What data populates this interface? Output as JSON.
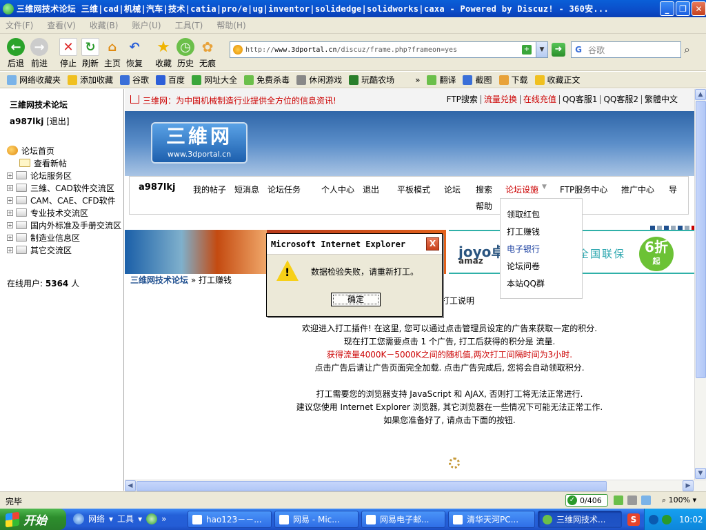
{
  "window": {
    "title": "三维网技术论坛 三维|cad|机械|汽车|技术|catia|pro/e|ug|inventor|solidedge|solidworks|caxa - Powered by Discuz! - 360安..."
  },
  "menubar": [
    "文件(F)",
    "查看(V)",
    "收藏(B)",
    "账户(U)",
    "工具(T)",
    "帮助(H)"
  ],
  "toolbar": {
    "back": "后退",
    "forward": "前进",
    "stop": "停止",
    "refresh": "刷新",
    "home": "主页",
    "restore": "恢复",
    "favorites": "收藏",
    "history": "历史",
    "incognito": "无痕",
    "url_prefix": "http://",
    "url_host": "www.3dportal.cn",
    "url_path": "/discuz/frame.php?frameon=yes",
    "search_placeholder": "谷歌"
  },
  "favbar": {
    "items": [
      "网络收藏夹",
      "添加收藏",
      "谷歌",
      "百度",
      "网址大全",
      "免费杀毒",
      "休闲游戏",
      "玩酷农场"
    ],
    "right": [
      "翻译",
      "截图",
      "下载",
      "收藏正文"
    ]
  },
  "left": {
    "title": "三維网技术论坛",
    "username": "a987lkj",
    "logout": "[退出]",
    "tree": [
      "论坛首页",
      "查看新帖",
      "论坛服务区",
      "三維、CAD软件交流区",
      "CAM、CAE、CFD软件",
      "专业技术交流区",
      "国内外标准及手册交流区",
      "制造业信息区",
      "其它交流区"
    ],
    "online_label": "在线用户:",
    "online_count": "5364",
    "online_unit": "人"
  },
  "main": {
    "notice": "三维网：为中国机械制造行业提供全方位的信息资讯!",
    "toplinks": [
      "FTP搜索",
      "流量兑换",
      "在线充值",
      "QQ客服1",
      "QQ客服2",
      "繁體中文"
    ],
    "logo_cn": "三維网",
    "logo_en": "www.3dportal.cn",
    "nav": {
      "user": "a987lkj",
      "items": [
        "我的帖子",
        "短消息",
        "论坛任务",
        "个人中心",
        "退出",
        "平板模式",
        "论坛",
        "搜索",
        "论坛设施",
        "FTP服务中心",
        "推广中心",
        "导"
      ],
      "help": "帮助"
    },
    "dropdown": [
      "领取红包",
      "打工赚钱",
      "电子银行",
      "论坛问卷",
      "本站QQ群"
    ],
    "ad": {
      "joyo": "joyo卓",
      "amazon": "amaz",
      "lianbao": "全国联保",
      "discount": "6折",
      "discount_suffix": "起"
    },
    "breadcrumb_home": "三维网技术论坛",
    "breadcrumb_sep": "»",
    "breadcrumb_current": "打工赚钱",
    "explain_title": "打工说明",
    "lines": [
      "欢迎进入打工插件! 在这里, 您可以通过点击管理员设定的广告来获取一定的积分.",
      "现在打工您需要点击 1 个广告, 打工后获得的积分是 流量.",
      "获得流量4000K－5000K之间的随机值,两次打工间隔时间为3小时.",
      "点击广告后请让广告页面完全加载. 点击广告完成后, 您将会自动领取积分.",
      "打工需要您的浏览器支持 JavaScript 和 AJAX, 否则打工将无法正常进行.",
      "建议您使用 Internet Explorer 浏览器, 其它浏览器在一些情况下可能无法正常工作.",
      "如果您准备好了, 请点击下面的按钮."
    ]
  },
  "dialog": {
    "title": "Microsoft Internet Explorer",
    "message": "数据检验失败，请重新打工。",
    "ok": "确定",
    "close": "X"
  },
  "status": {
    "text": "完毕",
    "counter": "0/406",
    "zoom": "100%"
  },
  "taskbar": {
    "start": "开始",
    "quick": [
      "网络",
      "工具"
    ],
    "tasks": [
      "hao123－－...",
      "网易 - Mic...",
      "网易电子邮...",
      "清华天河PC...",
      "三维网技术..."
    ],
    "clock": "10:02"
  },
  "colors": {
    "title_bar": "#0b4dc9",
    "accent_red": "#cc0000",
    "link_blue": "#1f4f8f",
    "taskbar": "#245dd6"
  }
}
